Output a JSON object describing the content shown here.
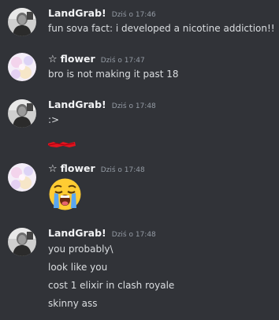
{
  "messages": [
    {
      "username": "LandGrab!",
      "timestamp": "Dziś o 17:46",
      "lines": [
        "fun sova fact: i developed a nicotine addiction!!"
      ],
      "avatar": "bw-person-avatar"
    },
    {
      "username": "flower",
      "badge": "☆",
      "timestamp": "Dziś o 17:47",
      "lines": [
        "bro is not making it past 18"
      ],
      "avatar": "pastel-flower-avatar"
    },
    {
      "username": "LandGrab!",
      "timestamp": "Dziś o 17:48",
      "lines": [
        ":>"
      ],
      "attachment": "red-scribble-redaction",
      "avatar": "bw-person-avatar"
    },
    {
      "username": "flower",
      "badge": "☆",
      "timestamp": "Dziś o 17:48",
      "emoji": "loudly-crying-face-emoji",
      "avatar": "pastel-flower-avatar"
    },
    {
      "username": "LandGrab!",
      "timestamp": "Dziś o 17:48",
      "lines": [
        "you probably\\",
        "look like you",
        "cost 1 elixir in clash royale",
        "skinny ass"
      ],
      "avatar": "bw-person-avatar"
    }
  ],
  "colors": {
    "background": "#313338",
    "username": "#f2f3f5",
    "timestamp": "#949ba4",
    "text": "#dbdee1",
    "redaction": "#e0141e",
    "emoji_face": "#ffcc33",
    "emoji_tears": "#5aa7f0"
  }
}
